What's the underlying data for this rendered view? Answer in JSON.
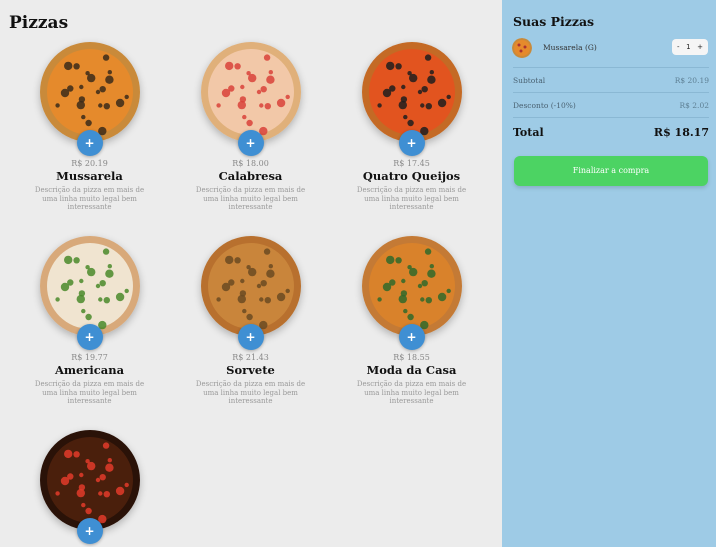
{
  "main": {
    "title": "Pizzas"
  },
  "pizzas": [
    {
      "name": "Mussarela",
      "price": "R$ 20.19",
      "description": "Descrição da pizza em mais de uma linha muito legal bem interessante",
      "add_label": "+",
      "crust": "#c98a3a",
      "sauce": "#e58a2c",
      "topping": "#3b2a1a"
    },
    {
      "name": "Calabresa",
      "price": "R$ 18.00",
      "description": "Descrição da pizza em mais de uma linha muito legal bem interessante",
      "add_label": "+",
      "crust": "#e0b07a",
      "sauce": "#f2c8a8",
      "topping": "#d9423a"
    },
    {
      "name": "Quatro Queijos",
      "price": "R$ 17.45",
      "description": "Descrição da pizza em mais de uma linha muito legal bem interessante",
      "add_label": "+",
      "crust": "#c46a25",
      "sauce": "#e2541f",
      "topping": "#1f1f1f"
    },
    {
      "name": "Americana",
      "price": "R$ 19.77",
      "description": "Descrição da pizza em mais de uma linha muito legal bem interessante",
      "add_label": "+",
      "crust": "#d8a97a",
      "sauce": "#f0e4d0",
      "topping": "#4a8a2a"
    },
    {
      "name": "Sorvete",
      "price": "R$ 21.43",
      "description": "Descrição da pizza em mais de uma linha muito legal bem interessante",
      "add_label": "+",
      "crust": "#b8702e",
      "sauce": "#c9853b",
      "topping": "#6b4a22"
    },
    {
      "name": "Moda da Casa",
      "price": "R$ 18.55",
      "description": "Descrição da pizza em mais de uma linha muito legal bem interessante",
      "add_label": "+",
      "crust": "#c47a35",
      "sauce": "#d9822b",
      "topping": "#2f6a2a"
    },
    {
      "name": "",
      "price": "",
      "description": "",
      "add_label": "+",
      "crust": "#2a1208",
      "sauce": "#4a1f0c",
      "topping": "#e23b2a"
    }
  ],
  "cart": {
    "title": "Suas Pizzas",
    "item": {
      "name": "Mussarela (G)",
      "qty_minus": "-",
      "qty": "1",
      "qty_plus": "+"
    },
    "subtotal_label": "Subtotal",
    "subtotal_value": "R$ 20.19",
    "discount_label": "Desconto (-10%)",
    "discount_value": "R$ 2.02",
    "total_label": "Total",
    "total_value": "R$ 18.17",
    "checkout_label": "Finalizar a compra"
  },
  "colors": {
    "accent": "#3f8fd3",
    "sidebar": "#9ecbe6",
    "checkout": "#4cd363"
  }
}
